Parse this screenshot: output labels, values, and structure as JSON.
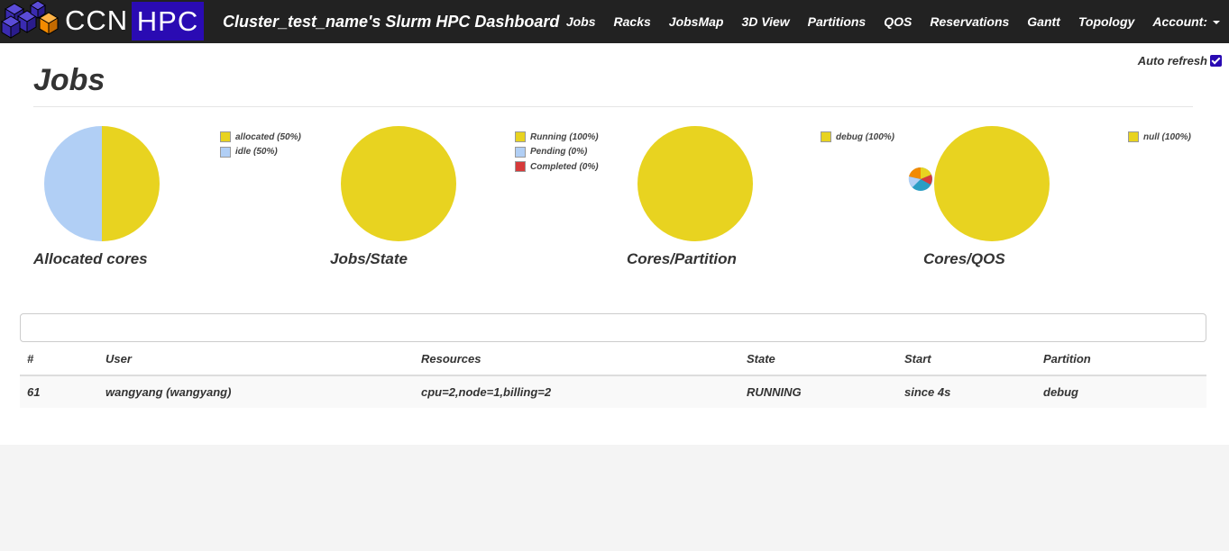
{
  "app": {
    "brand_ccn": "CCN",
    "brand_hpc": "HPC",
    "title": "Cluster_test_name's Slurm HPC Dashboard",
    "accent_color": "#2a0bb3"
  },
  "nav": {
    "items": [
      "Jobs",
      "Racks",
      "JobsMap",
      "3D View",
      "Partitions",
      "QOS",
      "Reservations",
      "Gantt",
      "Topology"
    ],
    "account_label": "Account:"
  },
  "page": {
    "title": "Jobs",
    "auto_refresh_label": "Auto refresh",
    "auto_refresh_checked": true
  },
  "charts": [
    {
      "label": "Allocated cores",
      "legend": [
        {
          "text": "allocated (50%)",
          "color": "#e8d320"
        },
        {
          "text": "idle (50%)",
          "color": "#b1cff5"
        }
      ]
    },
    {
      "label": "Jobs/State",
      "legend": [
        {
          "text": "Running (100%)",
          "color": "#e8d320"
        },
        {
          "text": "Pending (0%)",
          "color": "#b1cff5"
        },
        {
          "text": "Completed (0%)",
          "color": "#d63a3a"
        }
      ]
    },
    {
      "label": "Cores/Partition",
      "legend": [
        {
          "text": "debug (100%)",
          "color": "#e8d320"
        }
      ]
    },
    {
      "label": "Cores/QOS",
      "legend": [
        {
          "text": "null (100%)",
          "color": "#e8d320"
        }
      ]
    }
  ],
  "chart_data": [
    {
      "type": "pie",
      "title": "Allocated cores",
      "categories": [
        "allocated",
        "idle"
      ],
      "values": [
        50,
        50
      ],
      "colors": [
        "#e8d320",
        "#b1cff5"
      ]
    },
    {
      "type": "pie",
      "title": "Jobs/State",
      "categories": [
        "Running",
        "Pending",
        "Completed"
      ],
      "values": [
        100,
        0,
        0
      ],
      "colors": [
        "#e8d320",
        "#b1cff5",
        "#d63a3a"
      ]
    },
    {
      "type": "pie",
      "title": "Cores/Partition",
      "categories": [
        "debug"
      ],
      "values": [
        100
      ],
      "colors": [
        "#e8d320"
      ]
    },
    {
      "type": "pie",
      "title": "Cores/QOS",
      "categories": [
        "null"
      ],
      "values": [
        100
      ],
      "colors": [
        "#e8d320"
      ]
    }
  ],
  "table": {
    "filter_placeholder": "",
    "columns": [
      "#",
      "User",
      "Resources",
      "State",
      "Start",
      "Partition"
    ],
    "rows": [
      [
        "61",
        "wangyang (wangyang)",
        "cpu=2,node=1,billing=2",
        "RUNNING",
        "since 4s",
        "debug"
      ]
    ]
  }
}
